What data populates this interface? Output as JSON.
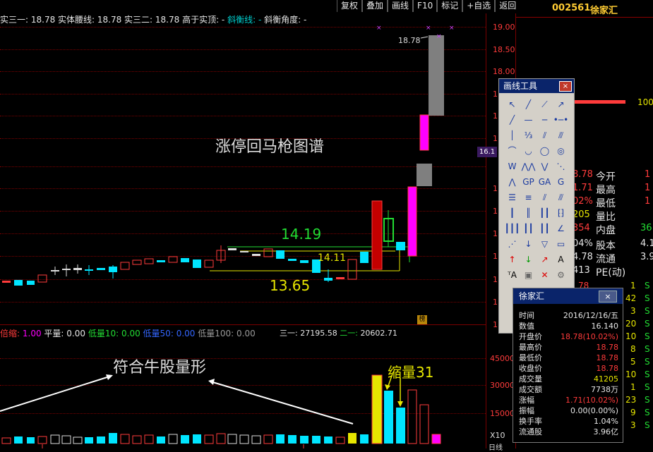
{
  "toolbar": {
    "items": [
      "复权",
      "叠加",
      "画线",
      "F10",
      "标记",
      "+自选",
      "返回"
    ]
  },
  "stock": {
    "code": "002561",
    "name": "徐家汇"
  },
  "indicators": {
    "line": "实三一: 18.78 实体腰线: 18.78 实三二: 18.78 高于实顶: -",
    "balance": "斜衡线: -",
    "angle": "斜衡角度: -"
  },
  "price_axis": [
    "19.00",
    "18.50",
    "18.00",
    "1",
    "1",
    "1",
    "1",
    "1",
    "1",
    "1",
    "1",
    "1",
    "1"
  ],
  "current_price_tag": "16.1",
  "annotations": {
    "chart_title": "涨停回马枪图谱",
    "level_high": "14.19",
    "level_mid": "14.11",
    "level_low": "13.65",
    "top_label": "18.78",
    "bang": "榜",
    "volume_title": "符合牛股量形",
    "shrink": "缩量31"
  },
  "volume_line": {
    "ratio_label": "倍缩:",
    "ratio_value": "1.00",
    "flat_label": "平量:",
    "flat_value": "0.00",
    "low10_label": "低量10:",
    "low10_value": "0.00",
    "low50_label": "低量50:",
    "low50_value": "0.00",
    "low100_label": "低量100:",
    "low100_value": "0.00",
    "diff1_label": "三一:",
    "diff1_value": "27195.58",
    "diff2_label": "二一:",
    "diff2_value": "20602.71"
  },
  "volume_axis": [
    "45000",
    "30000",
    "15000",
    "X10"
  ],
  "bottom_axis_label": "日线",
  "right_panel": {
    "top_value": "100",
    "rows": [
      {
        "val": "8.78",
        "label": "今开",
        "r": "1"
      },
      {
        "val": "1.71",
        "label": "最高",
        "r": "1"
      },
      {
        "val": "02%",
        "label": "最低",
        "r": "1"
      },
      {
        "val": "205",
        "label": "量比",
        "r": ""
      },
      {
        "val": "354",
        "label": "内盘",
        "r": "36"
      },
      {
        "val": "04%",
        "label": "股本",
        "r": "4.1"
      },
      {
        "val": "4.78",
        "label": "流通",
        "r": "3.9"
      },
      {
        "val": "413",
        "label": "PE(动)",
        "r": ""
      }
    ],
    "trades": [
      {
        "v": "78",
        "n": "1",
        "s": "S"
      },
      {
        "v": "",
        "n": "42",
        "s": "S"
      },
      {
        "v": "",
        "n": "3",
        "s": "S"
      },
      {
        "v": "",
        "n": "20",
        "s": "S"
      },
      {
        "v": "",
        "n": "10",
        "s": "S"
      },
      {
        "v": "",
        "n": "8",
        "s": "S"
      },
      {
        "v": "",
        "n": "5",
        "s": "S"
      },
      {
        "v": "",
        "n": "10",
        "s": "S"
      },
      {
        "v": "",
        "n": "1",
        "s": "S"
      },
      {
        "v": "",
        "n": "23",
        "s": "S"
      },
      {
        "v": "",
        "n": "9",
        "s": "S"
      },
      {
        "v": "",
        "n": "3",
        "s": "S"
      }
    ]
  },
  "draw_tool": {
    "title": "画线工具",
    "close": "×"
  },
  "info_popup": {
    "title": "徐家汇",
    "close": "×",
    "rows": [
      {
        "k": "时间",
        "v": "2016/12/16/五",
        "c": "#e6e6e6"
      },
      {
        "k": "数值",
        "v": "16.140",
        "c": "#e6e6e6"
      },
      {
        "k": "开盘价",
        "v": "18.78(10.02%)",
        "c": "#ff3b3b"
      },
      {
        "k": "最高价",
        "v": "18.78",
        "c": "#ff3b3b"
      },
      {
        "k": "最低价",
        "v": "18.78",
        "c": "#ff3b3b"
      },
      {
        "k": "收盘价",
        "v": "18.78",
        "c": "#ff3b3b"
      },
      {
        "k": "成交量",
        "v": "41205",
        "c": "#e6e600"
      },
      {
        "k": "成交额",
        "v": "7738万",
        "c": "#e6e6e6"
      },
      {
        "k": "涨幅",
        "v": "1.71(10.02%)",
        "c": "#ff3b3b"
      },
      {
        "k": "振幅",
        "v": "0.00(0.00%)",
        "c": "#e6e6e6"
      },
      {
        "k": "换手率",
        "v": "1.04%",
        "c": "#e6e6e6"
      },
      {
        "k": "流通股",
        "v": "3.96亿",
        "c": "#e6e6e6"
      }
    ]
  },
  "colors": {
    "up": "#ff3b3b",
    "down": "#00e5ff",
    "bg": "#000000",
    "limit": "#ff00ff",
    "grid": "#7a0000"
  }
}
